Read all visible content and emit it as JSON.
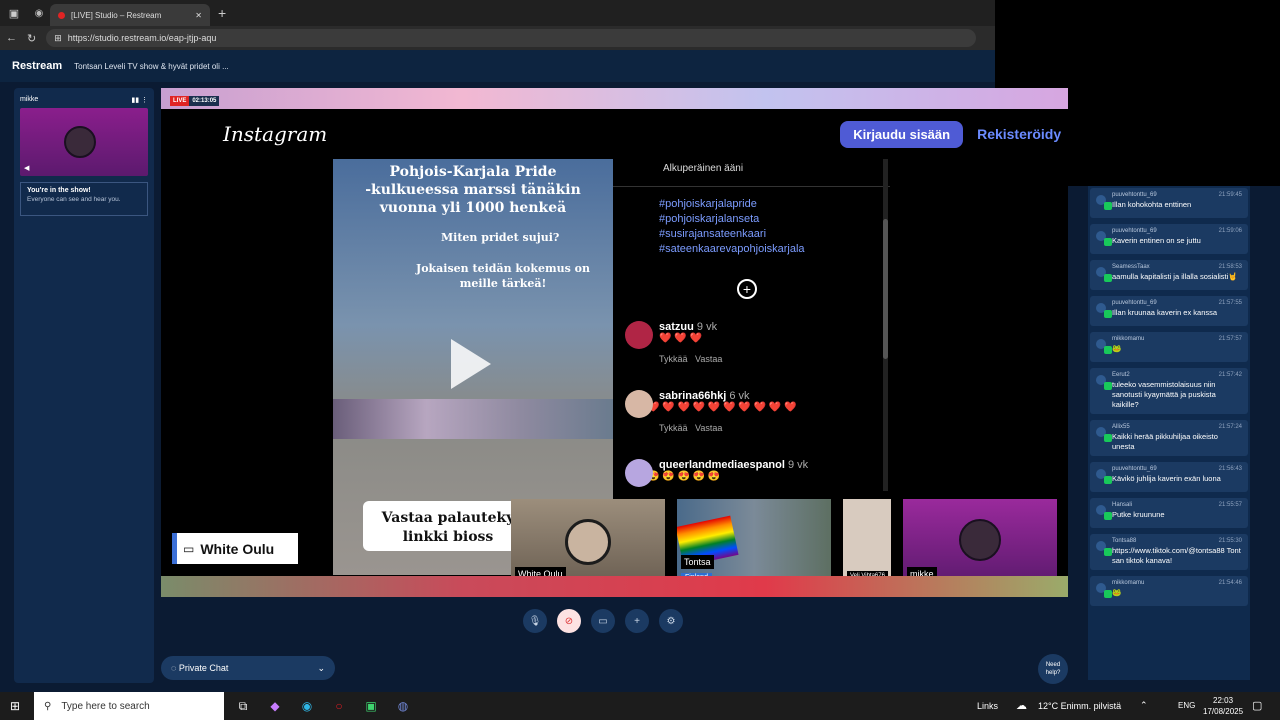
{
  "browser": {
    "tab_title": "[LIVE] Studio – Restream",
    "url": "https://studio.restream.io/eap-jtjp-aqu"
  },
  "app": {
    "brand": "Restream",
    "stream_title": "Tontsan Leveli TV show & hyvät pridet oli ..."
  },
  "left_panel": {
    "participant": "mikke",
    "show_title": "You're in the show!",
    "show_sub": "Everyone can see and hear you."
  },
  "stage": {
    "live_badge": "LIVE",
    "timer": "02:13:05",
    "instagram": {
      "logo": "Instagram",
      "login": "Kirjaudu sisään",
      "register": "Rekisteröidy"
    },
    "post_text": [
      "Pohjois-Karjala Pride",
      "-kulkueessa marssi tänäkin",
      "vuonna yli 1000 henkeä"
    ],
    "post_q1": "Miten pridet sujui?",
    "post_q2": [
      "Jokaisen teidän kokemus on",
      "meille tärkeä!"
    ],
    "post_bottom": [
      "Vastaa palauteky",
      "linkki bioss"
    ],
    "original_audio": "Alkuperäinen ääni",
    "hashtags": [
      "#pohjoiskarjalapride",
      "#pohjoiskarjalanseta",
      "#susirajansateenkaari",
      "#sateenkaarevapohjoiskarjala"
    ],
    "comments": [
      {
        "user": "satzuu",
        "age": "9 vk",
        "text": "❤️ ❤️ ❤️",
        "like": "Tykkää",
        "reply": "Vastaa"
      },
      {
        "user": "sabrina66hkj",
        "age": "6 vk",
        "text": "❤️ ❤️ ❤️ ❤️ ❤️ ❤️ ❤️ ❤️ ❤️ ❤️",
        "like": "Tykkää",
        "reply": "Vastaa"
      },
      {
        "user": "queerlandmediaespanol",
        "age": "9 vk",
        "text": "😍 😍 😍 😍 😍"
      }
    ],
    "banner": "White Oulu",
    "tiles": [
      {
        "name": "White Oulu"
      },
      {
        "name": "Tontsa",
        "sub": "Finland"
      },
      {
        "name": "Veli Vihta676"
      },
      {
        "name": "mikke"
      }
    ]
  },
  "chat": [
    {
      "user": "puuvehtonttu_69",
      "time": "21:59:45",
      "text": "Illan kohokohta enttinen"
    },
    {
      "user": "puuvehtonttu_69",
      "time": "21:59:06",
      "text": "Kaverin entinen on se juttu"
    },
    {
      "user": "SeamessTaax",
      "time": "21:58:53",
      "text": "aamulla kapitalisti ja illalla sosialisti🤘"
    },
    {
      "user": "puuvehtonttu_69",
      "time": "21:57:55",
      "text": "Illan kruunaa kaverin ex kanssa"
    },
    {
      "user": "mikkomamu",
      "time": "21:57:57",
      "text": "🐸"
    },
    {
      "user": "Eerut2",
      "time": "21:57:42",
      "text": "tuleeko vasemmistolaisuus niin sanotusti kyaymättä ja puskista kaikille?"
    },
    {
      "user": "Allix55",
      "time": "21:57:24",
      "text": "Kaikki herää pikkuhiljaa oikeisto unesta"
    },
    {
      "user": "puuvehtonttu_69",
      "time": "21:56:43",
      "text": "Kävikö juhlija kaverin exän luona"
    },
    {
      "user": "Hansali",
      "time": "21:55:57",
      "text": "Putke kruunune"
    },
    {
      "user": "Tontsa88",
      "time": "21:55:30",
      "text": "https://www.tiktok.com/@tontsa88 Tontsan tiktok kanava!"
    },
    {
      "user": "mikkomamu",
      "time": "21:54:46",
      "text": "🐸"
    }
  ],
  "controls": {
    "private_chat": "Private Chat",
    "need_help": "Need help?"
  },
  "taskbar": {
    "search": "Type here to search",
    "links": "Links",
    "weather": "12°C  Enimm. pilvistä",
    "lang": "ENG",
    "time": "22:03",
    "date": "17/08/2025"
  }
}
